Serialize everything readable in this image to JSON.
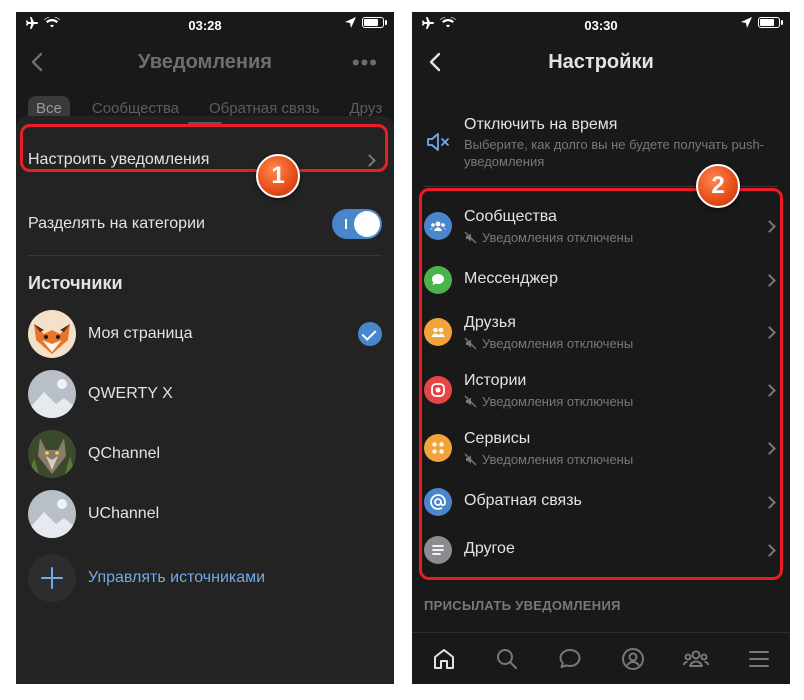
{
  "left_phone": {
    "status": {
      "time": "03:28"
    },
    "title": "Уведомления",
    "tabs": [
      "Все",
      "Сообщества",
      "Обратная связь",
      "Друз"
    ],
    "configure_label": "Настроить уведомления",
    "split_label": "Разделять на категории",
    "split_enabled": true,
    "sources_title": "Источники",
    "sources": [
      {
        "name": "Моя страница",
        "selected": true
      },
      {
        "name": "QWERTY X",
        "selected": false
      },
      {
        "name": "QChannel",
        "selected": false
      },
      {
        "name": "UChannel",
        "selected": false
      }
    ],
    "manage_label": "Управлять источниками",
    "badge": "1"
  },
  "right_phone": {
    "status": {
      "time": "03:30"
    },
    "title": "Настройки",
    "mute": {
      "label": "Отключить на время",
      "description": "Выберите, как долго вы не будете получать push-уведомления"
    },
    "items": [
      {
        "label": "Сообщества",
        "sub": "Уведомления отключены",
        "color": "#4986cc",
        "icon": "communities-icon"
      },
      {
        "label": "Мессенджер",
        "sub": "",
        "color": "#4bb34b",
        "icon": "messenger-icon"
      },
      {
        "label": "Друзья",
        "sub": "Уведомления отключены",
        "color": "#f2a33a",
        "icon": "friends-icon"
      },
      {
        "label": "Истории",
        "sub": "Уведомления отключены",
        "color": "#e64646",
        "icon": "stories-icon"
      },
      {
        "label": "Сервисы",
        "sub": "Уведомления отключены",
        "color": "#f2a33a",
        "icon": "services-icon"
      },
      {
        "label": "Обратная связь",
        "sub": "",
        "color": "#4986cc",
        "icon": "at-icon"
      },
      {
        "label": "Другое",
        "sub": "",
        "color": "#8a8c8f",
        "icon": "list-icon"
      }
    ],
    "send_section": "ПРИСЫЛАТЬ УВЕДОМЛЕНИЯ",
    "badge": "2",
    "tabbar": [
      "home-icon",
      "search-icon",
      "messages-icon",
      "profile-icon",
      "friends-tab-icon",
      "menu-icon"
    ]
  },
  "colors": {
    "highlight": "#ec1c24",
    "accent": "#71aaeb",
    "toggle": "#4986cc"
  }
}
